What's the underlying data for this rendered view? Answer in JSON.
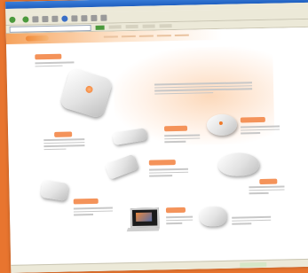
{
  "window": {
    "title": "",
    "menu": [],
    "toolbar_back": "",
    "status_text": ""
  },
  "colors": {
    "frame": "#e8752f",
    "accent": "#f4935a",
    "chrome": "#ece9d8"
  },
  "icons": {
    "back": "back-arrow-icon",
    "forward": "forward-arrow-icon",
    "go": "go-arrow-icon"
  }
}
